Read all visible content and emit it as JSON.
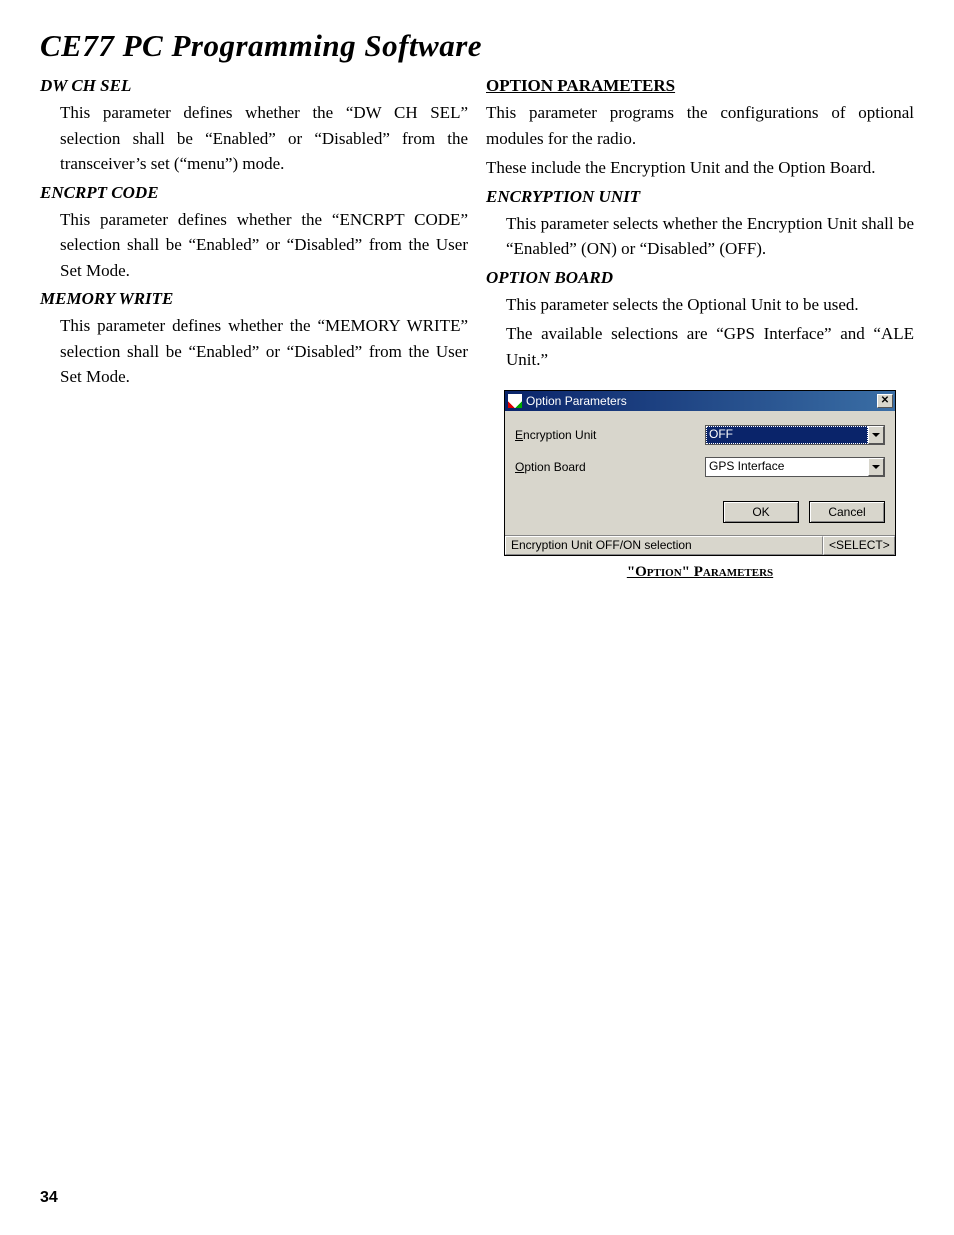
{
  "page": {
    "title": "CE77 PC Programming Software",
    "number": "34"
  },
  "left": {
    "s1": {
      "heading": "DW CH SEL",
      "body": "This parameter defines whether the “DW CH SEL” selection shall be “Enabled” or “Disabled” from the transceiver’s set (“menu”) mode."
    },
    "s2": {
      "heading": "ENCRPT CODE",
      "body": "This parameter defines whether the “ENCRPT CODE” selection shall be “Enabled” or “Disabled” from the User Set Mode."
    },
    "s3": {
      "heading": "MEMORY WRITE",
      "body": "This parameter defines whether the “MEMORY WRITE” selection shall be “Enabled” or “Disabled” from the User Set Mode."
    }
  },
  "right": {
    "header": "OPTION PARAMETERS",
    "intro1": "This parameter programs the configurations of optional modules for the radio.",
    "intro2": "These include the Encryption Unit and the Option Board.",
    "s1": {
      "heading": "ENCRYPTION UNIT",
      "body": "This parameter selects whether the Encryption Unit shall be “Enabled” (ON) or “Disabled” (OFF)."
    },
    "s2": {
      "heading": "OPTION BOARD",
      "body1": "This parameter selects the Optional Unit to be used.",
      "body2": "The available selections are “GPS Interface” and “ALE Unit.”"
    }
  },
  "dialog": {
    "title": "Option Parameters",
    "row1": {
      "label_pre": "E",
      "label_rest": "ncryption Unit",
      "value": "OFF"
    },
    "row2": {
      "label_pre": "O",
      "label_rest": "ption Board",
      "value": "GPS Interface"
    },
    "ok": "OK",
    "cancel": "Cancel",
    "status_left": "Encryption Unit OFF/ON selection",
    "status_right": "<SELECT>",
    "caption": "\"Oᴘᴛɪᴏɴ\" Pᴀʀᴀᴍᴇᴛᴇʀs"
  },
  "caption_raw": "\"Option\" Parameters"
}
